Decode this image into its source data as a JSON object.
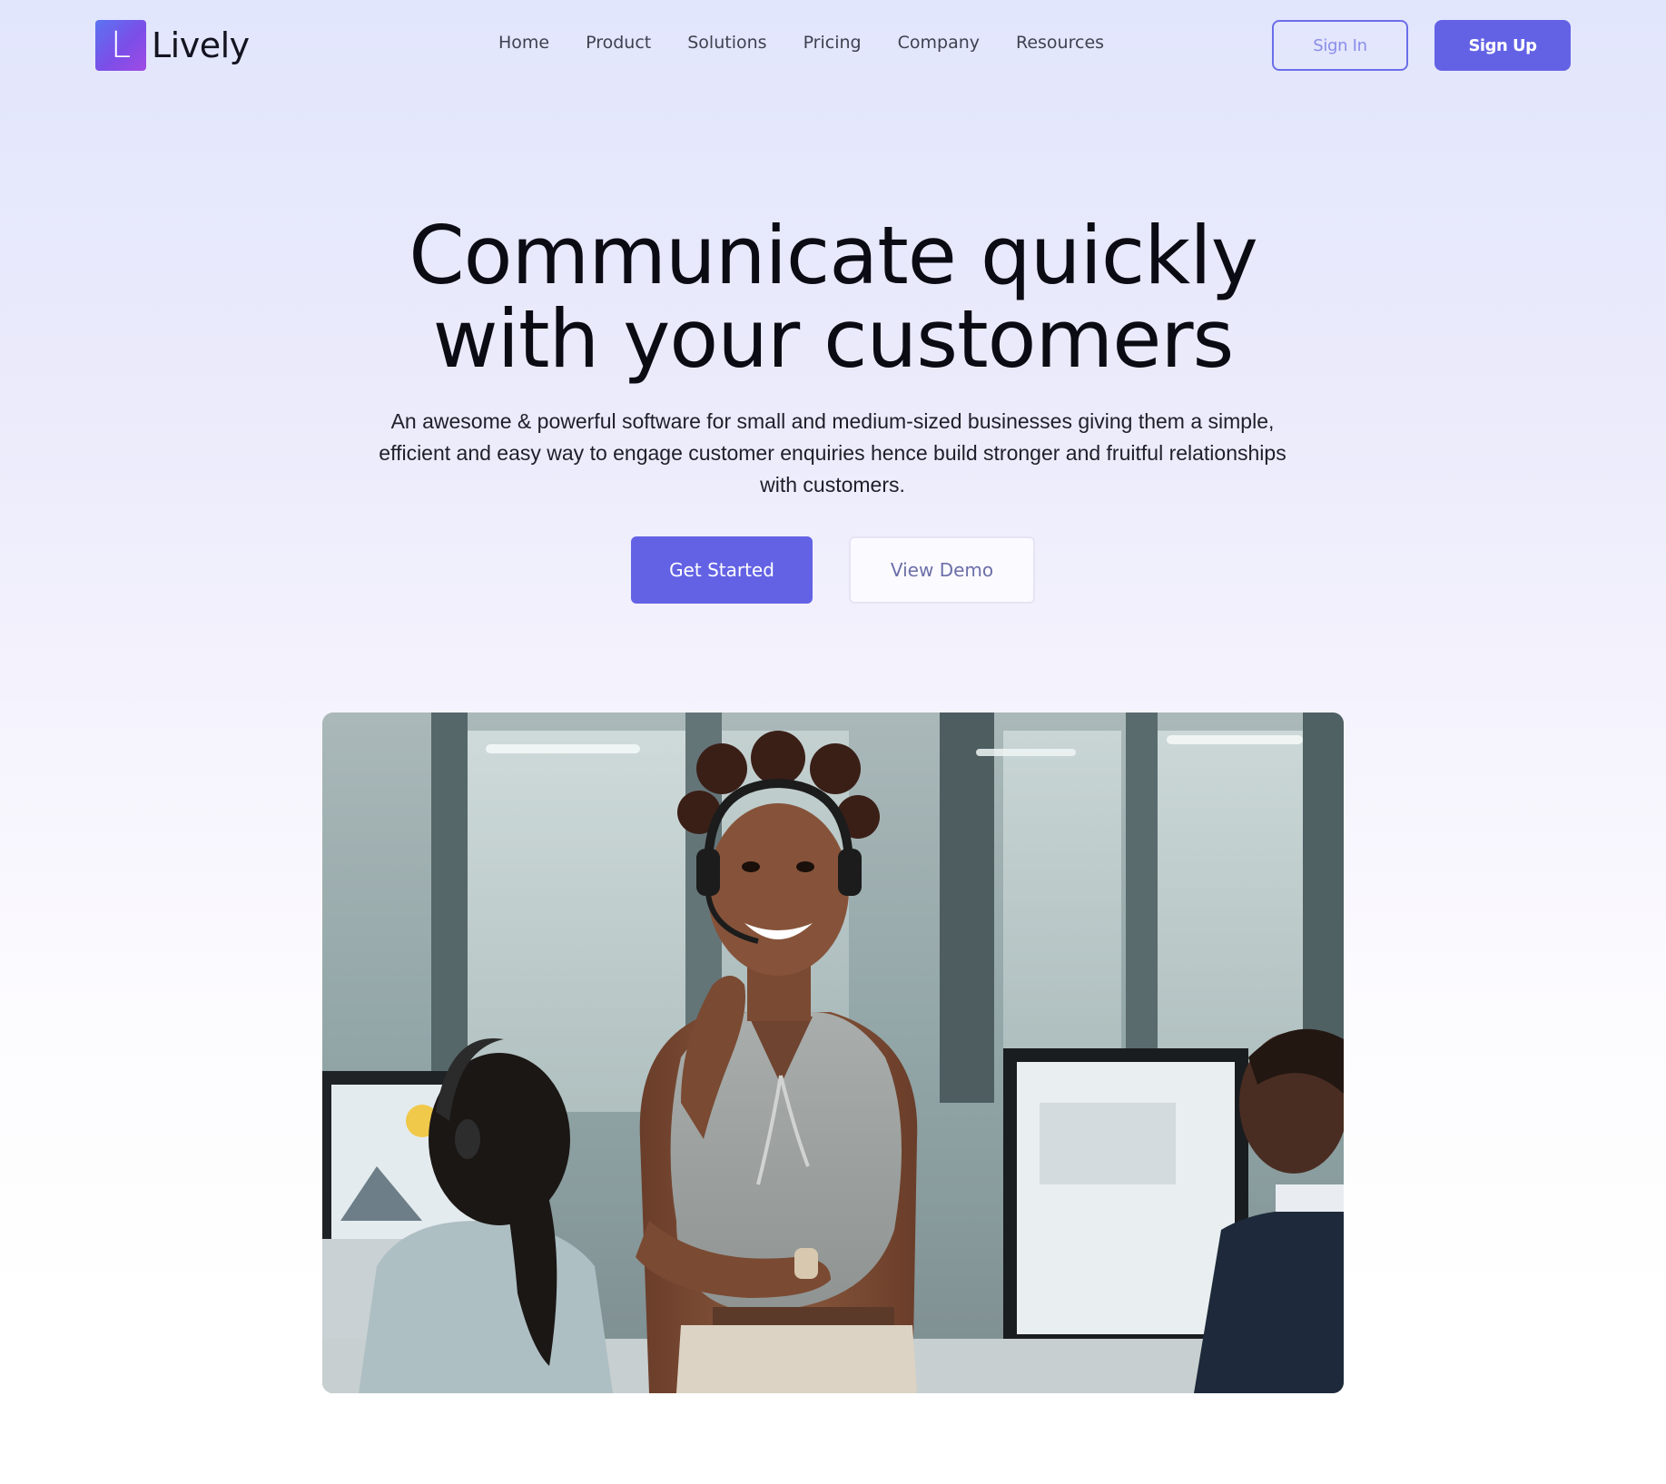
{
  "brand": {
    "logo_letter": "L",
    "name": "Lively",
    "accent_color": "#6362e5"
  },
  "nav": {
    "items": [
      {
        "label": "Home"
      },
      {
        "label": "Product"
      },
      {
        "label": "Solutions"
      },
      {
        "label": "Pricing"
      },
      {
        "label": "Company"
      },
      {
        "label": "Resources"
      }
    ]
  },
  "auth": {
    "sign_in_label": "Sign In",
    "sign_up_label": "Sign Up"
  },
  "hero": {
    "title_line1": "Communicate quickly",
    "title_line2": "with your customers",
    "subtitle": "An awesome & powerful software for small and medium-sized businesses giving them a simple, efficient and easy way to engage customer enquiries hence build stronger and fruitful relationships with customers.",
    "primary_cta": "Get Started",
    "secondary_cta": "View Demo"
  }
}
